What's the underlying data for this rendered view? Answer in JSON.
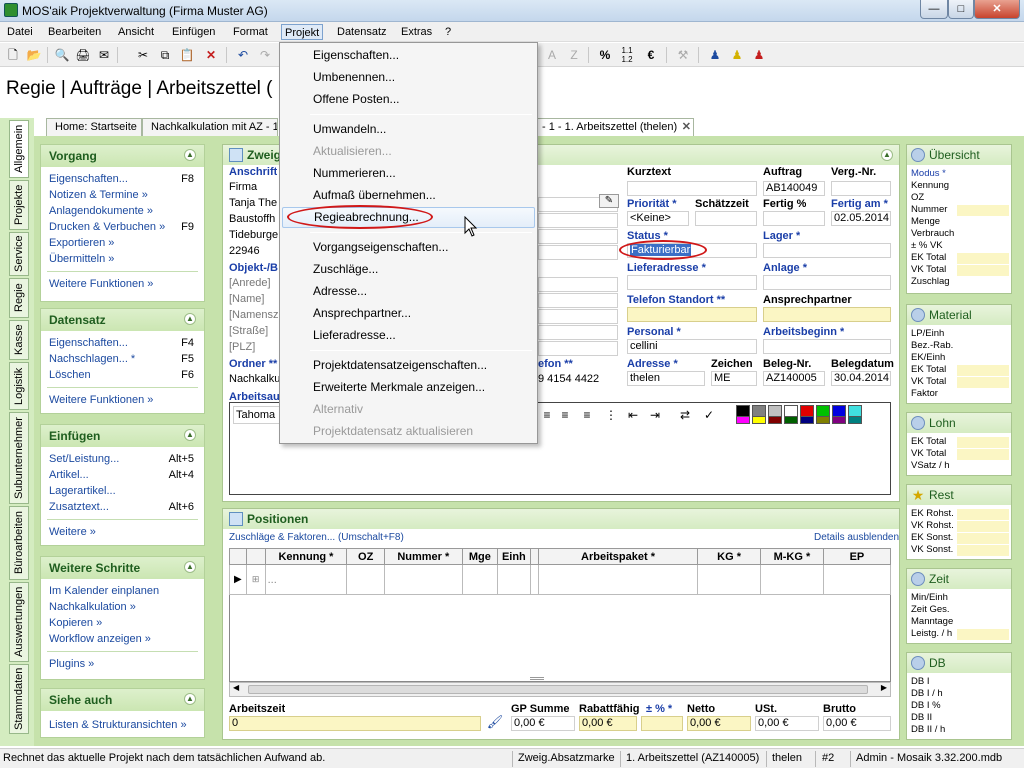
{
  "window": {
    "title": "MOS'aik Projektverwaltung (Firma Muster AG)"
  },
  "menubar": [
    "Datei",
    "Bearbeiten",
    "Ansicht",
    "Einfügen",
    "Format",
    "Projekt",
    "Datensatz",
    "Extras",
    "?"
  ],
  "page": {
    "heading": "Regie | Aufträge | Arbeitszettel ("
  },
  "doc_tabs": [
    "Home: Startseite",
    "Nachkalkulation mit AZ - 1 -",
    "- 1 - 1. Arbeitszettel (thelen)"
  ],
  "vertical_tabs": [
    "Allgemein",
    "Projekte",
    "Service",
    "Regie",
    "Kasse",
    "Logistik",
    "Subunternehmer",
    "Büroarbeiten",
    "Auswertungen",
    "Stammdaten"
  ],
  "left_panels": {
    "vorgang": {
      "title": "Vorgang",
      "items": [
        {
          "label": "Eigenschaften...",
          "key": "F8"
        },
        {
          "label": "Notizen & Termine »",
          "key": ""
        },
        {
          "label": "Anlagendokumente »",
          "key": ""
        },
        {
          "label": "Drucken & Verbuchen »",
          "key": "F9"
        },
        {
          "label": "Exportieren »",
          "key": ""
        },
        {
          "label": "Übermitteln »",
          "key": ""
        }
      ],
      "more": "Weitere Funktionen »"
    },
    "datensatz": {
      "title": "Datensatz",
      "items": [
        {
          "label": "Eigenschaften...",
          "key": "F4"
        },
        {
          "label": "Nachschlagen... *",
          "key": "F5"
        },
        {
          "label": "Löschen",
          "key": "F6"
        }
      ],
      "more": "Weitere Funktionen »"
    },
    "einfuegen": {
      "title": "Einfügen",
      "items": [
        {
          "label": "Set/Leistung...",
          "key": "Alt+5"
        },
        {
          "label": "Artikel...",
          "key": "Alt+4"
        },
        {
          "label": "Lagerartikel...",
          "key": ""
        },
        {
          "label": "Zusatztext...",
          "key": "Alt+6"
        }
      ],
      "more": "Weitere »"
    },
    "weitere": {
      "title": "Weitere Schritte",
      "items": [
        {
          "label": "Im Kalender einplanen",
          "key": ""
        },
        {
          "label": "Nachkalkulation »",
          "key": ""
        },
        {
          "label": "Kopieren »",
          "key": ""
        },
        {
          "label": "Workflow anzeigen »",
          "key": ""
        }
      ],
      "more": "Plugins »"
    },
    "siehe": {
      "title": "Siehe auch",
      "items": [
        {
          "label": "Listen & Strukturansichten »",
          "key": ""
        }
      ]
    }
  },
  "zweig": {
    "title": "Zweig",
    "anschrift_label": "Anschrift",
    "address": [
      "Firma",
      "Tanja The",
      "Baustoffh",
      "Tideburge",
      "22946"
    ],
    "objekt_label": "Objekt-/B",
    "objekt": [
      "[Anrede]",
      "[Name]",
      "[Namensz",
      "[Straße]",
      "[PLZ]"
    ],
    "ordner_label": "Ordner **",
    "ordner_value": "Nachkalku",
    "telefon_label": "efon **",
    "telefon_value": "9 4154 4422",
    "arbeitsauf_label": "Arbeitsau",
    "font": "Tahoma",
    "kurztext": "Kurztext",
    "auftrag_label": "Auftrag",
    "auftrag": "AB140049",
    "verg_nr": "Verg.-Nr.",
    "prioritaet_label": "Priorität *",
    "prioritaet": "<Keine>",
    "schaetzzeit": "Schätzzeit",
    "fertig_label": "Fertig %",
    "fertig_am_label": "Fertig am *",
    "fertig_am": "02.05.2014",
    "status_label": "Status *",
    "status": "Fakturierbar",
    "lager_label": "Lager *",
    "lieferadresse_label": "Lieferadresse *",
    "anlage_label": "Anlage *",
    "tel_standort_label": "Telefon Standort **",
    "ansprechpartner_label": "Ansprechpartner",
    "personal_label": "Personal *",
    "personal": "cellini",
    "arbeitsbeginn_label": "Arbeitsbeginn *",
    "adresse_label": "Adresse *",
    "adresse": "thelen",
    "zeichen_label": "Zeichen",
    "zeichen": "ME",
    "beleg_label": "Beleg-Nr.",
    "beleg": "AZ140005",
    "belegdatum_label": "Belegdatum",
    "belegdatum": "30.04.2014"
  },
  "positionen": {
    "title": "Positionen",
    "link": "Zuschläge & Faktoren... (Umschalt+F8)",
    "details": "Details ausblenden",
    "columns": [
      "Kennung *",
      "OZ",
      "Nummer *",
      "Mge",
      "Einh",
      "Arbeitspaket *",
      "KG *",
      "M-KG *",
      "EP"
    ],
    "row_placeholder": "...",
    "arbeitszeit_label": "Arbeitszeit",
    "arbeitszeit": "0",
    "summary": [
      {
        "label": "GP Summe",
        "value": "0,00 €"
      },
      {
        "label": "Rabattfähig",
        "value": "0,00 €"
      },
      {
        "label": "± % *",
        "value": ""
      },
      {
        "label": "Netto",
        "value": "0,00 €"
      },
      {
        "label": "USt.",
        "value": "0,00 €"
      },
      {
        "label": "Brutto",
        "value": "0,00 €"
      }
    ]
  },
  "right_panels": [
    {
      "title": "Übersicht",
      "rows": [
        "Modus *",
        "Kennung",
        "OZ",
        "Nummer",
        "Menge",
        "Verbrauch",
        "± % VK",
        "EK Total",
        "VK Total",
        "Zuschlag"
      ]
    },
    {
      "title": "Material",
      "rows": [
        "LP/Einh",
        "Bez.-Rab.",
        "EK/Einh",
        "EK Total",
        "VK Total",
        "Faktor"
      ]
    },
    {
      "title": "Lohn",
      "rows": [
        "EK Total",
        "VK Total",
        "VSatz / h"
      ]
    },
    {
      "title": "Rest",
      "rows": [
        "EK Rohst.",
        "VK Rohst.",
        "EK Sonst.",
        "VK Sonst."
      ]
    },
    {
      "title": "Zeit",
      "rows": [
        "Min/Einh",
        "Zeit Ges.",
        "Manntage",
        "Leistg. / h"
      ]
    },
    {
      "title": "DB",
      "rows": [
        "DB I",
        "DB I / h",
        "DB I %",
        "DB II",
        "DB II / h"
      ]
    }
  ],
  "dropdown": [
    {
      "label": "Eigenschaften...",
      "disabled": false
    },
    {
      "label": "Umbenennen...",
      "disabled": false
    },
    {
      "label": "Offene Posten...",
      "disabled": false
    },
    {
      "label": "Umwandeln...",
      "disabled": false
    },
    {
      "label": "Aktualisieren...",
      "disabled": true
    },
    {
      "label": "Nummerieren...",
      "disabled": false
    },
    {
      "label": "Aufmaß übernehmen...",
      "disabled": false
    },
    {
      "label": "Regieabrechnung...",
      "disabled": false
    },
    {
      "label": "Vorgangseigenschaften...",
      "disabled": false
    },
    {
      "label": "Zuschläge...",
      "disabled": false
    },
    {
      "label": "Adresse...",
      "disabled": false
    },
    {
      "label": "Ansprechpartner...",
      "disabled": false
    },
    {
      "label": "Lieferadresse...",
      "disabled": false
    },
    {
      "label": "Projektdatensatzeigenschaften...",
      "disabled": false
    },
    {
      "label": "Erweiterte Merkmale anzeigen...",
      "disabled": false
    },
    {
      "label": "Alternativ",
      "disabled": true
    },
    {
      "label": "Projektdatensatz aktualisieren",
      "disabled": true
    }
  ],
  "statusbar": {
    "message": "Rechnet das aktuelle Projekt nach dem tatsächlichen Aufwand ab.",
    "fields": [
      "Zweig.Absatzmarke",
      "1. Arbeitszettel (AZ140005)",
      "thelen",
      "#2",
      "Admin - Mosaik 3.32.200.mdb"
    ]
  },
  "colors": {
    "accent_red": "#d01818",
    "panel_green": "#c6e2ab",
    "header_text": "#1f5e1f",
    "link_blue": "#1c4aa0",
    "required_blue": "#1a3ea8",
    "highlight_yellow": "#fbf6c4"
  }
}
